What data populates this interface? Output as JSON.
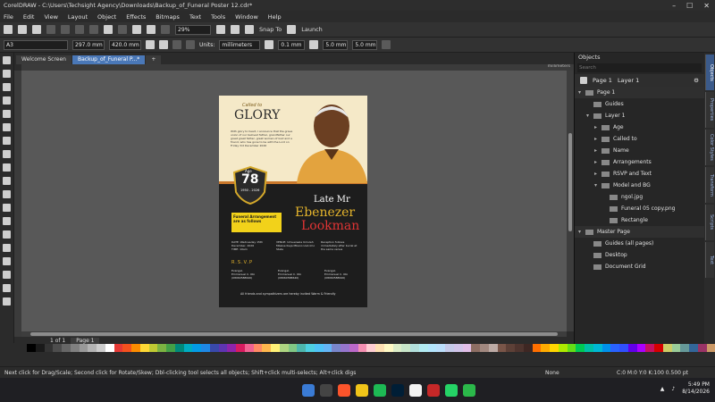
{
  "window": {
    "title": "CorelDRAW - C:\\Users\\Techsight Agency\\Downloads\\Backup_of_Funeral Poster 12.cdr*",
    "controls": [
      "–",
      "☐",
      "✕"
    ]
  },
  "menu": [
    "File",
    "Edit",
    "View",
    "Layout",
    "Object",
    "Effects",
    "Bitmaps",
    "Text",
    "Tools",
    "Window",
    "Help"
  ],
  "toolbar": {
    "zoom": "29%",
    "snap_to": "Snap To",
    "launch": "Launch"
  },
  "property_bar": {
    "page_size": "A3",
    "width": "297.0 mm",
    "height": "420.0 mm",
    "units_label": "Units:",
    "units": "millimeters",
    "nudge": "0.1 mm",
    "dup_x": "5.0 mm",
    "dup_y": "5.0 mm"
  },
  "tabs": [
    {
      "label": "Welcome Screen"
    },
    {
      "label": "Backup_of_Funeral P...*"
    },
    {
      "label": "+"
    }
  ],
  "ruler_label": "millimeters",
  "pager": {
    "position": "1 of 1",
    "page_tab": "Page 1"
  },
  "objects_panel": {
    "title": "Objects",
    "search_placeholder": "Search",
    "page_label": "Page 1",
    "layer_label": "Layer 1",
    "tree": [
      {
        "label": "Page 1",
        "level": 0,
        "caret": "▾"
      },
      {
        "label": "Guides",
        "level": 1,
        "caret": ""
      },
      {
        "label": "Layer 1",
        "level": 1,
        "caret": "▾"
      },
      {
        "label": "Age",
        "level": 2,
        "caret": "▸"
      },
      {
        "label": "Called to",
        "level": 2,
        "caret": "▸"
      },
      {
        "label": "Name",
        "level": 2,
        "caret": "▸"
      },
      {
        "label": "Arrangements",
        "level": 2,
        "caret": "▸"
      },
      {
        "label": "RSVP and Text",
        "level": 2,
        "caret": "▸"
      },
      {
        "label": "Model and BG",
        "level": 2,
        "caret": "▾"
      },
      {
        "label": "ngol.jpg",
        "level": 3,
        "caret": ""
      },
      {
        "label": "Funeral 05 copy.png",
        "level": 3,
        "caret": ""
      },
      {
        "label": "Rectangle",
        "level": 3,
        "caret": ""
      },
      {
        "label": "Master Page",
        "level": 0,
        "caret": "▾"
      },
      {
        "label": "Guides (all pages)",
        "level": 1,
        "caret": ""
      },
      {
        "label": "Desktop",
        "level": 1,
        "caret": ""
      },
      {
        "label": "Document Grid",
        "level": 1,
        "caret": ""
      }
    ]
  },
  "right_tabs": [
    "Objects",
    "Properties",
    "Color Styles",
    "Transform",
    "Scripts",
    "Text"
  ],
  "poster": {
    "called_to": "Called to",
    "glory": "GLORY",
    "intro": "With glory to heart, I announce that the grave union of our beloved father, grandfather our great great father, great women of God and a friend, who has gone to be with the Lord on Friday 3rd December 2026",
    "age_label": "Age",
    "age": "78",
    "years": "1950 - 2026",
    "late_mr": "Late Mr",
    "first_name": "Ebenezer",
    "last_name": "Lookman",
    "arrangements": "Funeral Arrangement are as follows",
    "date_line": "DATE: Wednesday 15th December, 2026",
    "time_line": "TIME: 10am",
    "venue_line": "VENUE: Umuezeala Umuleh Mbaise Ikeja Mbano LGA Imo State",
    "reception_line": "Reception follows immediately after burial at the same venue",
    "rsvp": "R.S.V.P",
    "evangelists": [
      {
        "title": "Evangel.",
        "name": "Emmanuel C. Obi",
        "phone": "(08060588640)"
      },
      {
        "title": "Evangel.",
        "name": "Emmanuel C. Obi",
        "phone": "(08060588640)"
      },
      {
        "title": "Evangel.",
        "name": "Emmanuel C. Obi",
        "phone": "(08060588640)"
      }
    ],
    "footer": "All friends and sympathizers are hereby invited Warm & Friendly"
  },
  "status": {
    "hint": "Next click for Drag/Scale; Second click for Rotate/Skew; Dbl-clicking tool selects all objects; Shift+click multi-selects; Alt+click digs",
    "fill": "None",
    "outline": "C:0 M:0 Y:0 K:100  0.500 pt"
  },
  "taskbar": {
    "time": "5:49 PM",
    "date": "8/14/2026"
  },
  "colors": {
    "accent": "#4a78b8",
    "poster_gold": "#e6b52c",
    "poster_red": "#e03434",
    "poster_yellow": "#f2d21a"
  },
  "palette": [
    "#000000",
    "#1a1a1a",
    "#333333",
    "#4d4d4d",
    "#666666",
    "#808080",
    "#999999",
    "#b3b3b3",
    "#cccccc",
    "#ffffff",
    "#e53935",
    "#f4511e",
    "#fb8c00",
    "#fdd835",
    "#c0ca33",
    "#7cb342",
    "#43a047",
    "#00897b",
    "#00acc1",
    "#039be5",
    "#1e88e5",
    "#3949ab",
    "#5e35b1",
    "#8e24aa",
    "#d81b60",
    "#f06292",
    "#ff8a65",
    "#ffb74d",
    "#fff176",
    "#aed581",
    "#81c784",
    "#4db6ac",
    "#4dd0e1",
    "#4fc3f7",
    "#64b5f6",
    "#7986cb",
    "#9575cd",
    "#ba68c8",
    "#f48fb1",
    "#ffcdd2",
    "#ffe0b2",
    "#fff9c4",
    "#dcedc8",
    "#c8e6c9",
    "#b2dfdb",
    "#b2ebf2",
    "#b3e5fc",
    "#bbdefb",
    "#c5cae9",
    "#d1c4e9",
    "#e1bee7",
    "#8d6e63",
    "#a1887f",
    "#bcaaa4",
    "#795548",
    "#5d4037",
    "#4e342e",
    "#3e2723",
    "#ff6f00",
    "#ffab00",
    "#ffd600",
    "#aeea00",
    "#64dd17",
    "#00c853",
    "#00bfa5",
    "#00b8d4",
    "#0091ea",
    "#2962ff",
    "#304ffe",
    "#6200ea",
    "#aa00ff",
    "#c51162",
    "#d50000",
    "#cccc66",
    "#99cc99",
    "#669999",
    "#336699",
    "#993366",
    "#cc9966"
  ]
}
